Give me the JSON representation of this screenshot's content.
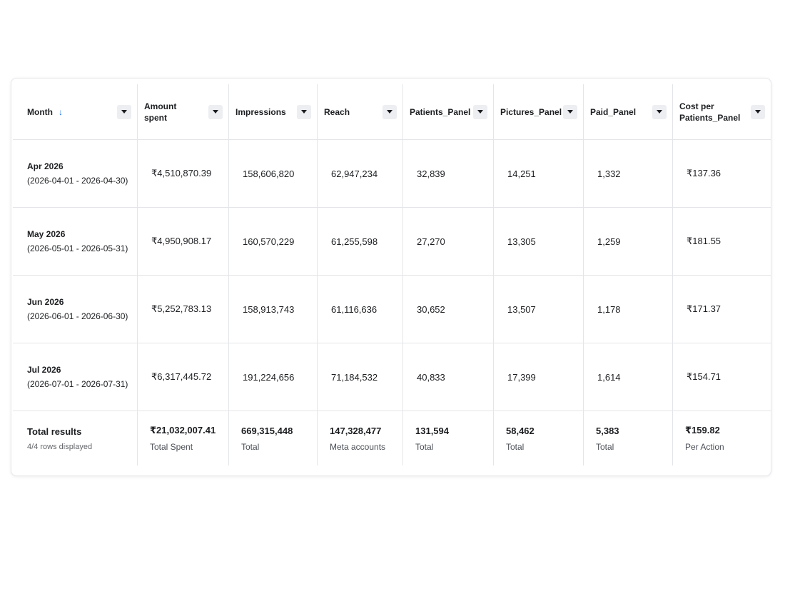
{
  "table": {
    "columns": [
      {
        "label": "Month",
        "sorted": "descending"
      },
      {
        "label": "Amount spent"
      },
      {
        "label": "Impressions"
      },
      {
        "label": "Reach"
      },
      {
        "label": "Patients_Panel"
      },
      {
        "label": "Pictures_Panel"
      },
      {
        "label": "Paid_Panel"
      },
      {
        "label": "Cost per Patients_Panel"
      }
    ],
    "rows": [
      {
        "month": "Apr 2026",
        "range": "(2026-04-01 - 2026-04-30)",
        "amount": "₹4,510,870.39",
        "impressions": "158,606,820",
        "reach": "62,947,234",
        "patients": "32,839",
        "pictures": "14,251",
        "paid": "1,332",
        "cost": "₹137.36"
      },
      {
        "month": "May 2026",
        "range": "(2026-05-01 - 2026-05-31)",
        "amount": "₹4,950,908.17",
        "impressions": "160,570,229",
        "reach": "61,255,598",
        "patients": "27,270",
        "pictures": "13,305",
        "paid": "1,259",
        "cost": "₹181.55"
      },
      {
        "month": "Jun 2026",
        "range": "(2026-06-01 - 2026-06-30)",
        "amount": "₹5,252,783.13",
        "impressions": "158,913,743",
        "reach": "61,116,636",
        "patients": "30,652",
        "pictures": "13,507",
        "paid": "1,178",
        "cost": "₹171.37"
      },
      {
        "month": "Jul 2026",
        "range": "(2026-07-01 - 2026-07-31)",
        "amount": "₹6,317,445.72",
        "impressions": "191,224,656",
        "reach": "71,184,532",
        "patients": "40,833",
        "pictures": "17,399",
        "paid": "1,614",
        "cost": "₹154.71"
      }
    ],
    "totals": {
      "label": "Total results",
      "rows_displayed": "4/4 rows displayed",
      "amount": {
        "value": "₹21,032,007.41",
        "sub": "Total Spent"
      },
      "impressions": {
        "value": "669,315,448",
        "sub": "Total"
      },
      "reach": {
        "value": "147,328,477",
        "sub": "Meta accounts"
      },
      "patients": {
        "value": "131,594",
        "sub": "Total"
      },
      "pictures": {
        "value": "58,462",
        "sub": "Total"
      },
      "paid": {
        "value": "5,383",
        "sub": "Total"
      },
      "cost": {
        "value": "₹159.82",
        "sub": "Per Action"
      }
    }
  },
  "icons": {
    "sort": "arrow-down-icon",
    "dropdown": "caret-down-icon"
  },
  "colors": {
    "sort_arrow": "#1a73e8",
    "border": "#e4e5e9",
    "dropdown_bg": "#eceef1"
  }
}
